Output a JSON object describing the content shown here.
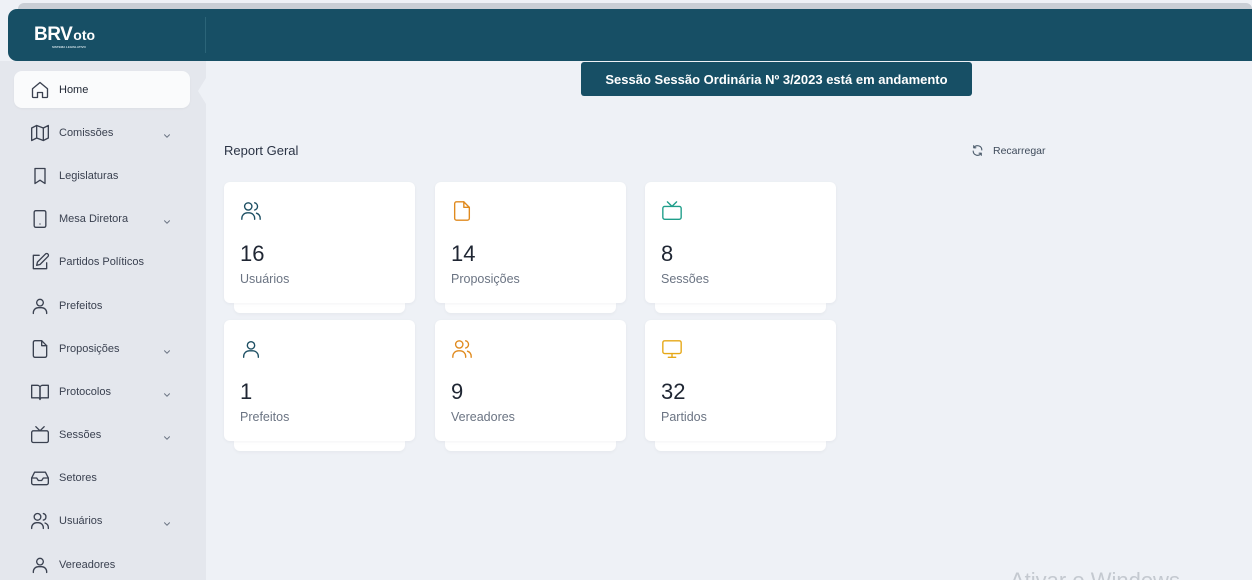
{
  "brand": {
    "name_part1": "BRV",
    "name_part2": "oto",
    "tagline": "SISTEMA LEGISLATIVO"
  },
  "sidebar": {
    "items": [
      {
        "label": "Home",
        "icon": "home-icon",
        "active": true,
        "has_submenu": false
      },
      {
        "label": "Comissões",
        "icon": "map-icon",
        "active": false,
        "has_submenu": true
      },
      {
        "label": "Legislaturas",
        "icon": "bookmark-icon",
        "active": false,
        "has_submenu": false
      },
      {
        "label": "Mesa Diretora",
        "icon": "tablet-icon",
        "active": false,
        "has_submenu": true
      },
      {
        "label": "Partidos Políticos",
        "icon": "edit-icon",
        "active": false,
        "has_submenu": false
      },
      {
        "label": "Prefeitos",
        "icon": "user-icon",
        "active": false,
        "has_submenu": false
      },
      {
        "label": "Proposições",
        "icon": "file-icon",
        "active": false,
        "has_submenu": true
      },
      {
        "label": "Protocolos",
        "icon": "book-icon",
        "active": false,
        "has_submenu": true
      },
      {
        "label": "Sessões",
        "icon": "tv-icon",
        "active": false,
        "has_submenu": true
      },
      {
        "label": "Setores",
        "icon": "inbox-icon",
        "active": false,
        "has_submenu": false
      },
      {
        "label": "Usuários",
        "icon": "users-icon",
        "active": false,
        "has_submenu": true
      },
      {
        "label": "Vereadores",
        "icon": "user-icon",
        "active": false,
        "has_submenu": false
      }
    ]
  },
  "banner": {
    "text": "Sessão Sessão Ordinária Nº 3/2023 está em andamento"
  },
  "report": {
    "title": "Report Geral",
    "reload_label": "Recarregar"
  },
  "cards": [
    {
      "value": "16",
      "label": "Usuários",
      "icon": "users-icon",
      "icon_color": "#1d4f63"
    },
    {
      "value": "14",
      "label": "Proposições",
      "icon": "file-icon",
      "icon_color": "#e08a1e"
    },
    {
      "value": "8",
      "label": "Sessões",
      "icon": "tv-icon",
      "icon_color": "#1f9e8a"
    },
    {
      "value": "1",
      "label": "Prefeitos",
      "icon": "user-icon",
      "icon_color": "#1d4f63"
    },
    {
      "value": "9",
      "label": "Vereadores",
      "icon": "users-icon",
      "icon_color": "#e08a1e"
    },
    {
      "value": "32",
      "label": "Partidos",
      "icon": "monitor-icon",
      "icon_color": "#e6a817"
    }
  ],
  "colors": {
    "primary": "#174f65",
    "background": "#eef1f6",
    "sidebar": "#e4e7ed"
  },
  "watermark": {
    "text": "Ativar o Windows"
  }
}
